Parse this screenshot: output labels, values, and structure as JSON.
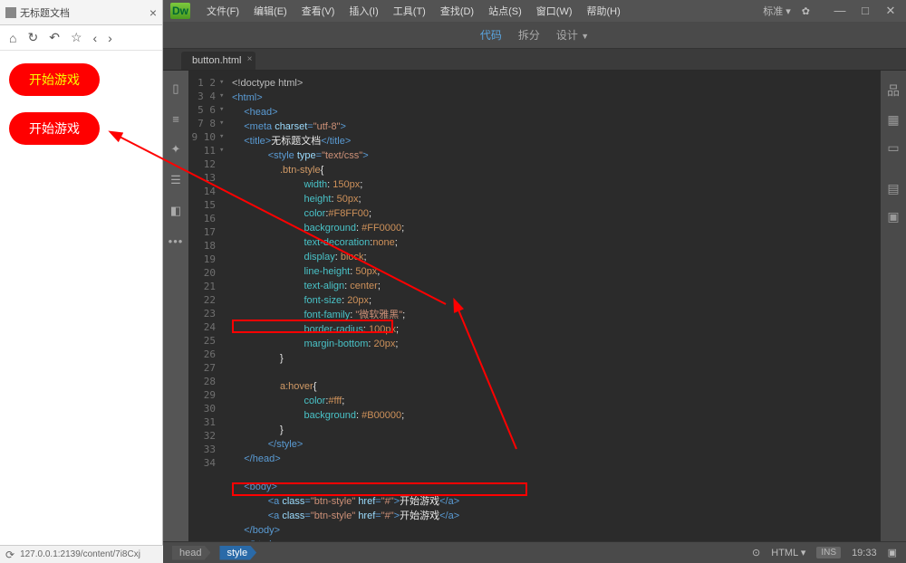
{
  "browser": {
    "tab_title": "无标题文档",
    "nav_icons": {
      "home": "⌂",
      "reload": "↻",
      "undo": "↶",
      "fav": "☆",
      "back": "‹",
      "fwd": "›"
    },
    "buttons": [
      "开始游戏",
      "开始游戏"
    ],
    "status": "127.0.0.1:2139/content/7i8Cxj"
  },
  "dw": {
    "logo": "Dw",
    "menu": [
      "文件(F)",
      "编辑(E)",
      "查看(V)",
      "插入(I)",
      "工具(T)",
      "查找(D)",
      "站点(S)",
      "窗口(W)",
      "帮助(H)"
    ],
    "mode_label": "标准",
    "docbar": {
      "code": "代码",
      "split": "拆分",
      "design": "设计"
    },
    "file_tab": "button.html",
    "icon_rail": [
      "▯",
      "≡",
      "✦",
      "☰",
      "◧",
      "•••"
    ],
    "right_rail": [
      "品",
      "▦",
      "▭",
      "",
      "▤",
      "▣"
    ],
    "breadcrumb": [
      "head",
      "style"
    ],
    "bottom": {
      "odot": "⊙",
      "lang": "HTML",
      "ins": "INS",
      "time": "19:33"
    }
  },
  "code": {
    "lines": [
      {
        "n": 1,
        "f": "",
        "tok": [
          {
            "c": "t-doc",
            "t": "<!doctype html>"
          }
        ]
      },
      {
        "n": 2,
        "f": "▾",
        "tok": [
          {
            "c": "t-tag",
            "t": "<html>"
          }
        ]
      },
      {
        "n": 3,
        "f": "▾",
        "tok": [
          {
            "c": "t-tag",
            "t": "<head>"
          }
        ],
        "ind": 1
      },
      {
        "n": 4,
        "f": "",
        "tok": [
          {
            "c": "t-tag",
            "t": "<meta "
          },
          {
            "c": "t-attr",
            "t": "charset"
          },
          {
            "c": "t-tag",
            "t": "="
          },
          {
            "c": "t-str",
            "t": "\"utf-8\""
          },
          {
            "c": "t-tag",
            "t": ">"
          }
        ],
        "ind": 1
      },
      {
        "n": 5,
        "f": "",
        "tok": [
          {
            "c": "t-tag",
            "t": "<title>"
          },
          {
            "c": "t-txt",
            "t": "无标题文档"
          },
          {
            "c": "t-tag",
            "t": "</title>"
          }
        ],
        "ind": 1
      },
      {
        "n": 6,
        "f": "▾",
        "tok": [
          {
            "c": "t-tag",
            "t": "<style "
          },
          {
            "c": "t-attr",
            "t": "type"
          },
          {
            "c": "t-tag",
            "t": "="
          },
          {
            "c": "t-str",
            "t": "\"text/css\""
          },
          {
            "c": "t-tag",
            "t": ">"
          }
        ],
        "ind": 3
      },
      {
        "n": 7,
        "f": "▾",
        "tok": [
          {
            "c": "t-sel",
            "t": ".btn-style"
          },
          {
            "c": "t-txt",
            "t": "{"
          }
        ],
        "ind": 4
      },
      {
        "n": 8,
        "f": "",
        "tok": [
          {
            "c": "t-prop",
            "t": "width"
          },
          {
            "c": "t-txt",
            "t": ": "
          },
          {
            "c": "t-val",
            "t": "150px"
          },
          {
            "c": "t-txt",
            "t": ";"
          }
        ],
        "ind": 6
      },
      {
        "n": 9,
        "f": "",
        "tok": [
          {
            "c": "t-prop",
            "t": "height"
          },
          {
            "c": "t-txt",
            "t": ": "
          },
          {
            "c": "t-val",
            "t": "50px"
          },
          {
            "c": "t-txt",
            "t": ";"
          }
        ],
        "ind": 6
      },
      {
        "n": 10,
        "f": "",
        "tok": [
          {
            "c": "t-prop",
            "t": "color"
          },
          {
            "c": "t-txt",
            "t": ":"
          },
          {
            "c": "t-val",
            "t": "#F8FF00"
          },
          {
            "c": "t-txt",
            "t": ";"
          }
        ],
        "ind": 6
      },
      {
        "n": 11,
        "f": "",
        "tok": [
          {
            "c": "t-prop",
            "t": "background"
          },
          {
            "c": "t-txt",
            "t": ": "
          },
          {
            "c": "t-val",
            "t": "#FF0000"
          },
          {
            "c": "t-txt",
            "t": ";"
          }
        ],
        "ind": 6
      },
      {
        "n": 12,
        "f": "",
        "tok": [
          {
            "c": "t-prop",
            "t": "text-decoration"
          },
          {
            "c": "t-txt",
            "t": ":"
          },
          {
            "c": "t-val",
            "t": "none"
          },
          {
            "c": "t-txt",
            "t": ";"
          }
        ],
        "ind": 6
      },
      {
        "n": 13,
        "f": "",
        "tok": [
          {
            "c": "t-prop",
            "t": "display"
          },
          {
            "c": "t-txt",
            "t": ": "
          },
          {
            "c": "t-val",
            "t": "block"
          },
          {
            "c": "t-txt",
            "t": ";"
          }
        ],
        "ind": 6
      },
      {
        "n": 14,
        "f": "",
        "tok": [
          {
            "c": "t-prop",
            "t": "line-height"
          },
          {
            "c": "t-txt",
            "t": ": "
          },
          {
            "c": "t-val",
            "t": "50px"
          },
          {
            "c": "t-txt",
            "t": ";"
          }
        ],
        "ind": 6
      },
      {
        "n": 15,
        "f": "",
        "tok": [
          {
            "c": "t-prop",
            "t": "text-align"
          },
          {
            "c": "t-txt",
            "t": ": "
          },
          {
            "c": "t-val",
            "t": "center"
          },
          {
            "c": "t-txt",
            "t": ";"
          }
        ],
        "ind": 6
      },
      {
        "n": 16,
        "f": "",
        "tok": [
          {
            "c": "t-prop",
            "t": "font-size"
          },
          {
            "c": "t-txt",
            "t": ": "
          },
          {
            "c": "t-val",
            "t": "20px"
          },
          {
            "c": "t-txt",
            "t": ";"
          }
        ],
        "ind": 6
      },
      {
        "n": 17,
        "f": "",
        "tok": [
          {
            "c": "t-prop",
            "t": "font-family"
          },
          {
            "c": "t-txt",
            "t": ": "
          },
          {
            "c": "t-str",
            "t": "\"微软雅黑\""
          },
          {
            "c": "t-txt",
            "t": ";"
          }
        ],
        "ind": 6
      },
      {
        "n": 18,
        "f": "",
        "tok": [
          {
            "c": "t-prop",
            "t": "border-radius"
          },
          {
            "c": "t-txt",
            "t": ": "
          },
          {
            "c": "t-val",
            "t": "100px"
          },
          {
            "c": "t-txt",
            "t": ";"
          }
        ],
        "ind": 6
      },
      {
        "n": 19,
        "f": "",
        "tok": [
          {
            "c": "t-prop",
            "t": "margin-bottom"
          },
          {
            "c": "t-txt",
            "t": ": "
          },
          {
            "c": "t-val",
            "t": "20px"
          },
          {
            "c": "t-txt",
            "t": ";"
          }
        ],
        "ind": 6
      },
      {
        "n": 20,
        "f": "",
        "tok": [
          {
            "c": "t-txt",
            "t": "}"
          }
        ],
        "ind": 4
      },
      {
        "n": 21,
        "f": "",
        "tok": [],
        "ind": 0
      },
      {
        "n": 22,
        "f": "▾",
        "tok": [
          {
            "c": "t-sel",
            "t": "a:hover"
          },
          {
            "c": "t-txt",
            "t": "{"
          }
        ],
        "ind": 4
      },
      {
        "n": 23,
        "f": "",
        "tok": [
          {
            "c": "t-prop",
            "t": "color"
          },
          {
            "c": "t-txt",
            "t": ":"
          },
          {
            "c": "t-val",
            "t": "#fff"
          },
          {
            "c": "t-txt",
            "t": ";"
          }
        ],
        "ind": 6
      },
      {
        "n": 24,
        "f": "",
        "tok": [
          {
            "c": "t-prop",
            "t": "background"
          },
          {
            "c": "t-txt",
            "t": ": "
          },
          {
            "c": "t-val",
            "t": "#B00000"
          },
          {
            "c": "t-txt",
            "t": ";"
          }
        ],
        "ind": 6
      },
      {
        "n": 25,
        "f": "",
        "tok": [
          {
            "c": "t-txt",
            "t": "}"
          }
        ],
        "ind": 4
      },
      {
        "n": 26,
        "f": "",
        "tok": [
          {
            "c": "t-tag",
            "t": "</style>"
          }
        ],
        "ind": 3
      },
      {
        "n": 27,
        "f": "",
        "tok": [
          {
            "c": "t-tag",
            "t": "</head>"
          }
        ],
        "ind": 1
      },
      {
        "n": 28,
        "f": "",
        "tok": [],
        "ind": 0
      },
      {
        "n": 29,
        "f": "▾",
        "tok": [
          {
            "c": "t-tag",
            "t": "<body>"
          }
        ],
        "ind": 1
      },
      {
        "n": 30,
        "f": "",
        "tok": [
          {
            "c": "t-tag",
            "t": "<a "
          },
          {
            "c": "t-attr",
            "t": "class"
          },
          {
            "c": "t-tag",
            "t": "="
          },
          {
            "c": "t-str",
            "t": "\"btn-style\""
          },
          {
            "c": "t-tag",
            "t": " "
          },
          {
            "c": "t-attr",
            "t": "href"
          },
          {
            "c": "t-tag",
            "t": "="
          },
          {
            "c": "t-str",
            "t": "\"#\""
          },
          {
            "c": "t-tag",
            "t": ">"
          },
          {
            "c": "t-txt",
            "t": "开始游戏"
          },
          {
            "c": "t-tag",
            "t": "</a>"
          }
        ],
        "ind": 3
      },
      {
        "n": 31,
        "f": "",
        "tok": [
          {
            "c": "t-tag",
            "t": "<a "
          },
          {
            "c": "t-attr",
            "t": "class"
          },
          {
            "c": "t-tag",
            "t": "="
          },
          {
            "c": "t-str",
            "t": "\"btn-style\""
          },
          {
            "c": "t-tag",
            "t": " "
          },
          {
            "c": "t-attr",
            "t": "href"
          },
          {
            "c": "t-tag",
            "t": "="
          },
          {
            "c": "t-str",
            "t": "\"#\""
          },
          {
            "c": "t-tag",
            "t": ">"
          },
          {
            "c": "t-txt",
            "t": "开始游戏"
          },
          {
            "c": "t-tag",
            "t": "</a>"
          }
        ],
        "ind": 3
      },
      {
        "n": 32,
        "f": "",
        "tok": [
          {
            "c": "t-tag",
            "t": "</body>"
          }
        ],
        "ind": 1
      },
      {
        "n": 33,
        "f": "",
        "tok": [
          {
            "c": "t-tag",
            "t": "</html>"
          }
        ],
        "ind": 1
      },
      {
        "n": 34,
        "f": "",
        "tok": [],
        "ind": 0
      }
    ]
  }
}
